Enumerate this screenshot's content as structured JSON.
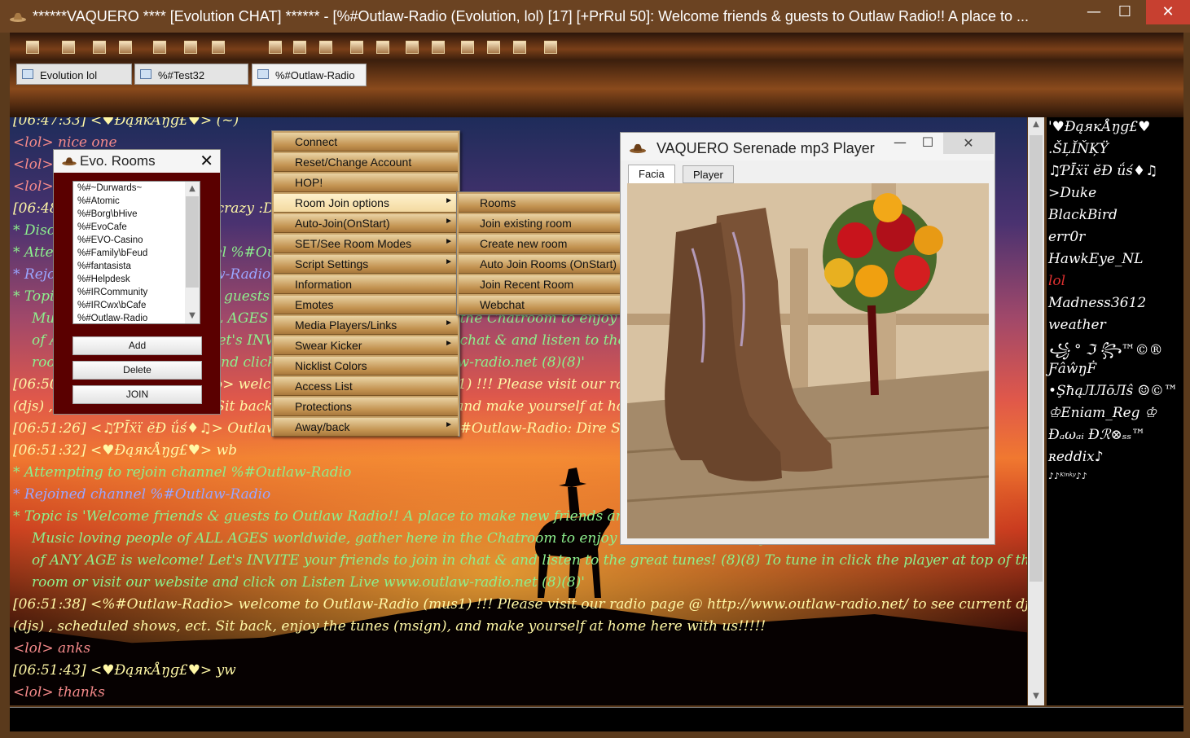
{
  "window": {
    "title": "******VAQUERO **** [Evolution CHAT] ****** - [%#Outlaw-Radio (Evolution, lol) [17] [+PrRul 50]: Welcome friends & guests to Outlaw Radio!! A place to ...",
    "min": "—",
    "max": "☐",
    "close": "✕"
  },
  "tabs": [
    {
      "label": "Evolution lol"
    },
    {
      "label": "%#Test32"
    },
    {
      "label": "%#Outlaw-Radio"
    }
  ],
  "chat_lines": [
    {
      "text": "[06:47:33] <♥ĐąякÅŋɡ£♥> (~)",
      "color": "ly"
    },
    {
      "text": "<lol> nice one",
      "color": "lp"
    },
    {
      "text": "<lol> hello € ",
      "color": "lp"
    },
    {
      "text": "<lol> nice one £",
      "color": "lp"
    },
    {
      "text": "[06:48:01] <♥ĐąякÅŋɡ£♥> crazy :D",
      "color": "ly"
    },
    {
      "text": "* Disconnected",
      "color": "lc"
    },
    {
      "text": "* Attempting to rejoin channel %#Outlaw-Radio",
      "color": "lc"
    },
    {
      "text": "* Rejoined channel %#Outlaw-Radio",
      "color": "lb"
    },
    {
      "text": "* Topic is 'Welcome friends & guests to Outlaw Radio!! A place to make new friends and to have fun with other Fun,",
      "color": "lc"
    },
    {
      "text": "Music loving people of ALL AGES worldwide, gather here in the Chatroom to enjoy Outlaw Radio! Everyone",
      "color": "lc",
      "ind": true
    },
    {
      "text": "of ANY AGE is welcome! Let's INVITE your friends to join in chat & and listen to the great tunes! (8)(8) To tune",
      "color": "lc",
      "ind": true
    },
    {
      "text": "room or visit our website and click on Listen Live  www.outlaw-radio.net (8)(8)'",
      "color": "lc",
      "ind": true
    },
    {
      "text": "[06:50:00] <%#Outlaw-Radio> welcome to Outlaw-Radio (mus1) !!! Please visit our radio page @ http://www.outlaw-radio.net/",
      "color": "ly"
    },
    {
      "text": "(djs) , scheduled shows, ect. Sit back, enjoy the tunes (msign), and make yourself at home here with us!!!!!",
      "color": "ly"
    },
    {
      "text": "[06:51:26] <♫ƤĪẍϊ ĕĐ ǘś♦♫> Outlaw Radio: Now Playing on %#Outlaw-Radio: Dire Straits - ...",
      "color": "ly"
    },
    {
      "text": "[06:51:32] <♥ĐąякÅŋɡ£♥> wb",
      "color": "ly"
    },
    {
      "text": "* Attempting to rejoin channel %#Outlaw-Radio",
      "color": "lc"
    },
    {
      "text": "* Rejoined channel %#Outlaw-Radio",
      "color": "lb"
    },
    {
      "text": "* Topic is 'Welcome friends & guests to Outlaw Radio!! A place to make new friends and to have fun with other Fun,",
      "color": "lc"
    },
    {
      "text": "Music loving people of ALL AGES worldwide, gather here in the Chatroom to enjoy Outlaw Radio! Everyone",
      "color": "lc",
      "ind": true
    },
    {
      "text": "of ANY AGE is welcome! Let's INVITE your friends to join in chat & and listen to the great tunes! (8)(8) To tune in click the player at top of the",
      "color": "lc",
      "ind": true
    },
    {
      "text": "room or visit our website and click on Listen Live  www.outlaw-radio.net (8)(8)'",
      "color": "lc",
      "ind": true
    },
    {
      "text": "[06:51:38] <%#Outlaw-Radio> welcome to Outlaw-Radio (mus1) !!! Please visit our radio page @ http://www.outlaw-radio.net/ to see current dj's",
      "color": "ly"
    },
    {
      "text": "(djs) , scheduled shows, ect. Sit back, enjoy the tunes (msign), and make yourself at home here with us!!!!!",
      "color": "ly"
    },
    {
      "text": "<lol> anks",
      "color": "lp"
    },
    {
      "text": "[06:51:43] <♥ĐąякÅŋɡ£♥> yw",
      "color": "ly"
    },
    {
      "text": "<lol> thanks",
      "color": "lp"
    }
  ],
  "nicks": [
    "'♥ĐąякÅŋɡ£♥",
    ".ŠĻĬŇĶŸ",
    "♫ƤĪẍϊ ĕĐ ǘś♦♫",
    ">Duke",
    "BlackBird",
    "err0r",
    "HawkEye_NL",
    "lol",
    "Madness3612",
    "weather",
    "  ꧁ ° ℑ ꧂™©®",
    "ƑâŵŋḞ",
    "•ŞħąЛЛōЛŝ ☺©™",
    "♔Eniam_Reg ♔",
    "Ðₐωₐᵢ Ðℛ⊗ₛₛ™",
    "ʀeddix♪",
    "♪♪ᴷⁱⁿᵏʸ♪♪"
  ],
  "rooms": {
    "title": "Evo. Rooms",
    "list": [
      "%#~Durwards~",
      "%#Atomic",
      "%#Borg\\bHive",
      "%#EvoCafe",
      "%#EVO-Casino",
      "%#Family\\bFeud",
      "%#fantasista",
      "%#Helpdesk",
      "%#IRCommunity",
      "%#IRCwx\\bCafe",
      "%#Outlaw-Radio"
    ],
    "add": "Add",
    "delete": "Delete",
    "join": "JOIN",
    "close": "✕"
  },
  "menu": [
    {
      "label": "Connect"
    },
    {
      "label": "Reset/Change Account"
    },
    {
      "label": "HOP!"
    },
    {
      "label": "Room Join options",
      "sub": true
    },
    {
      "label": "Auto-Join(OnStart)",
      "sub": true
    },
    {
      "label": "SET/See Room Modes",
      "sub": true
    },
    {
      "label": "Script Settings",
      "sub": true
    },
    {
      "label": "Information"
    },
    {
      "label": "Emotes"
    },
    {
      "label": "Media Players/Links",
      "sub": true
    },
    {
      "label": "Swear Kicker",
      "sub": true
    },
    {
      "label": "Nicklist Colors"
    },
    {
      "label": "Access List"
    },
    {
      "label": "Protections"
    },
    {
      "label": "Away/back",
      "sub": true
    }
  ],
  "submenu": [
    {
      "label": "Rooms"
    },
    {
      "label": "Join existing room"
    },
    {
      "label": "Create new room"
    },
    {
      "label": "Auto Join Rooms (OnStart)"
    },
    {
      "label": "Join Recent Room",
      "sub": true
    },
    {
      "label": "Webchat"
    }
  ],
  "player": {
    "title": "VAQUERO Serenade mp3 Player",
    "tabs": [
      "Facia",
      "Player"
    ],
    "min": "—",
    "max": "☐",
    "close": "✕"
  },
  "arrow": "►",
  "up": "▲",
  "down": "▼"
}
